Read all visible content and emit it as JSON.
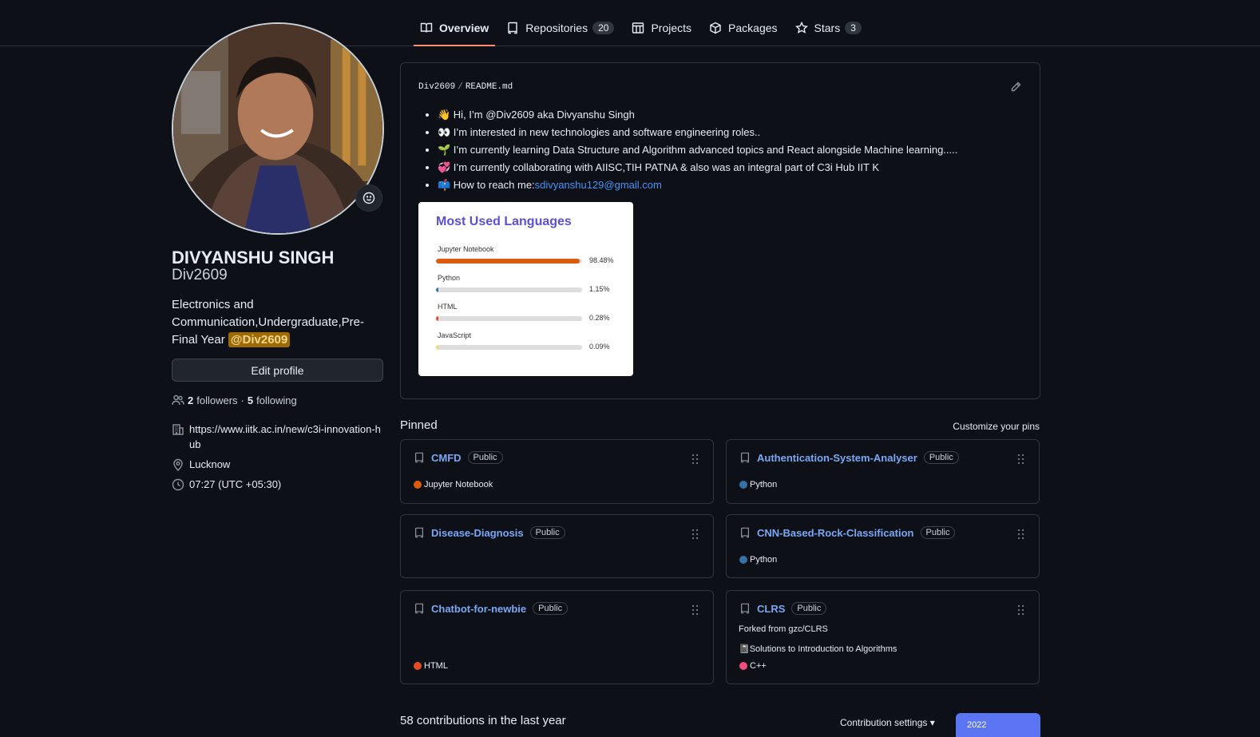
{
  "nav": {
    "tabs": [
      {
        "label": "Overview",
        "icon": "book-icon",
        "count": ""
      },
      {
        "label": "Repositories",
        "icon": "repo-icon",
        "count": "20"
      },
      {
        "label": "Projects",
        "icon": "table-icon",
        "count": ""
      },
      {
        "label": "Packages",
        "icon": "package-icon",
        "count": ""
      },
      {
        "label": "Stars",
        "icon": "star-icon",
        "count": "3"
      }
    ]
  },
  "profile": {
    "name": "DIVYANSHU SINGH",
    "login": "Div2609",
    "bio": "Electronics and Communication,Undergraduate,Pre-Final Year",
    "bio_mention": "@Div2609",
    "edit_label": "Edit profile",
    "followers_count": "2",
    "followers_label": "followers",
    "separator": "·",
    "following_count": "5",
    "following_label": "following",
    "website": "https://www.iitk.ac.in/new/c3i-innovation-hub",
    "location": "Lucknow",
    "local_time": "07:27 (UTC +05:30)"
  },
  "readme": {
    "owner": "Div2609",
    "file": "README.md",
    "items": [
      {
        "text": "👋 Hi, I’m @Div2609 aka Divyanshu Singh",
        "link": ""
      },
      {
        "text": "👀 I’m interested in new technologies and software engineering roles..",
        "link": ""
      },
      {
        "text": "🌱 I’m currently learning Data Structure and Algorithm advanced topics and React alongside Machine learning.....",
        "link": ""
      },
      {
        "text": "💞️ I’m currently collaborating with AIISC,TIH PATNA & also was an integral part of C3i Hub IIT K",
        "link": ""
      },
      {
        "text": "📫 How to reach me:",
        "link": "sdivyanshu129@gmail.com"
      }
    ],
    "lang_card": {
      "title": "Most Used Languages",
      "languages": [
        {
          "name": "Jupyter Notebook",
          "percent": "98.48%",
          "value": 98.48,
          "color": "#DA5B0B"
        },
        {
          "name": "Python",
          "percent": "1.15%",
          "value": 1.15,
          "color": "#3572A5"
        },
        {
          "name": "HTML",
          "percent": "0.28%",
          "value": 0.28,
          "color": "#e34c26"
        },
        {
          "name": "JavaScript",
          "percent": "0.09%",
          "value": 0.09,
          "color": "#f1e05a"
        }
      ]
    }
  },
  "pinned": {
    "title": "Pinned",
    "customize_label": "Customize your pins",
    "public_label": "Public",
    "repos": [
      {
        "name": "CMFD",
        "language": "Jupyter Notebook",
        "lang_color": "#DA5B0B",
        "fork_note": "",
        "description": ""
      },
      {
        "name": "Authentication-System-Analyser",
        "language": "Python",
        "lang_color": "#3572A5",
        "fork_note": "",
        "description": ""
      },
      {
        "name": "Disease-Diagnosis",
        "language": "",
        "lang_color": "",
        "fork_note": "",
        "description": ""
      },
      {
        "name": "CNN-Based-Rock-Classification",
        "language": "Python",
        "lang_color": "#3572A5",
        "fork_note": "",
        "description": ""
      },
      {
        "name": "Chatbot-for-newbie",
        "language": "HTML",
        "lang_color": "#e34c26",
        "fork_note": "",
        "description": ""
      },
      {
        "name": "CLRS",
        "language": "C++",
        "lang_color": "#f34b7d",
        "fork_note": "Forked from gzc/CLRS",
        "description": "📓Solutions to Introduction to Algorithms"
      }
    ]
  },
  "contributions": {
    "summary": "58 contributions in the last year",
    "settings_label": "Contribution settings ▾",
    "year": "2022"
  }
}
